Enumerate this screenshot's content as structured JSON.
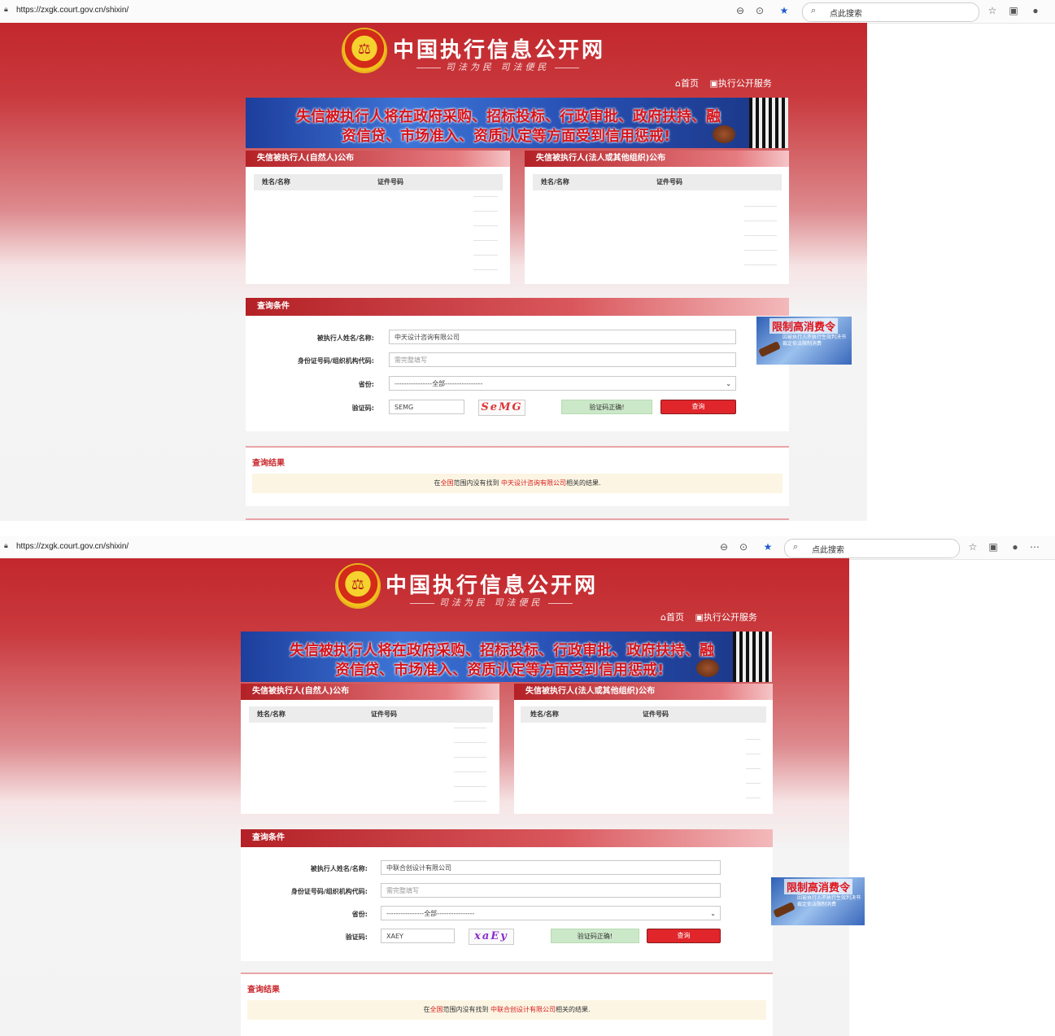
{
  "browser": {
    "url": "https://zxgk.court.gov.cn/shixin/",
    "search_placeholder": "点此搜索"
  },
  "site": {
    "title": "中国执行信息公开网",
    "slogan": "司法为民  司法便民",
    "nav": {
      "home": "首页",
      "services": "执行公开服务"
    }
  },
  "banner": {
    "line1": "失信被执行人将在政府采购、招标投标、行政审批、政府扶持、融",
    "line2": "资信贷、市场准入、资质认定等方面受到信用惩戒!"
  },
  "panels": {
    "natural_person": {
      "title": "失信被执行人(自然人)公布",
      "col_name": "姓名/名称",
      "col_id": "证件号码"
    },
    "legal_person": {
      "title": "失信被执行人(法人或其他组织)公布",
      "col_name": "姓名/名称",
      "col_id": "证件号码"
    }
  },
  "query": {
    "title": "查询条件",
    "name_label": "被执行人姓名/名称:",
    "id_label": "身份证号码/组织机构代码:",
    "id_placeholder": "需完整填写",
    "province_label": "省份:",
    "province_value": "----------------全部----------------",
    "captcha_label": "验证码:",
    "verify_ok": "验证码正确!",
    "submit": "查询"
  },
  "side_ad": {
    "title": "限制高消费令",
    "subtitle": "因被执行人不执行生效判决书裁定依法限制消费"
  },
  "result": {
    "title": "查询结果",
    "prefix": "在",
    "scope": "全国",
    "middle": "范围内没有找到 ",
    "suffix": "相关的结果."
  },
  "screens": [
    {
      "company": "中天设计咨询有限公司",
      "captcha_input": "SEMG",
      "captcha_image_text": "SeMG"
    },
    {
      "company": "中联合创设计有限公司",
      "captcha_input": "XAEY",
      "captcha_image_text": "xaEy"
    }
  ]
}
